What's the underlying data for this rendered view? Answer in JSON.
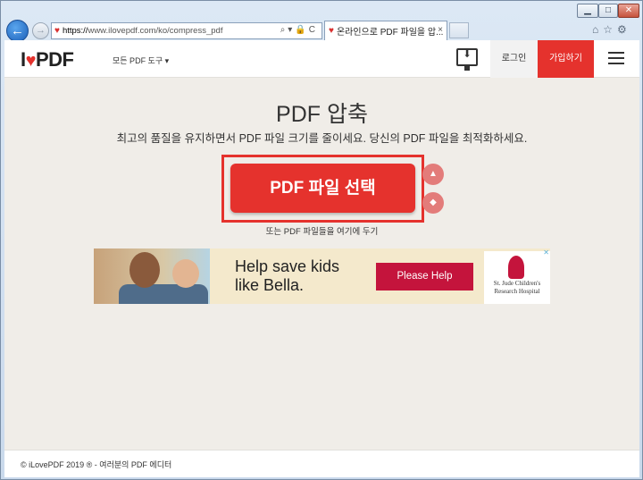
{
  "browser": {
    "window_buttons": {
      "minimize": "▁",
      "maximize": "□",
      "close": "✕"
    },
    "back_icon": "←",
    "forward_icon": "→",
    "address": {
      "protocol": "https://",
      "rest": "www.ilovepdf.com/ko/compress_pdf",
      "tools": "⌕▾🔒C"
    },
    "tab": {
      "title": "온라인으로 PDF 파일을 압...",
      "close": "×"
    },
    "tool_icons": "⌂☆⚙"
  },
  "header": {
    "logo_i": "I",
    "logo_pdf": "PDF",
    "tools_menu": "모든 PDF 도구 ▾",
    "desktop_icon": "⬇",
    "login": "로그인",
    "signup": "가입하기"
  },
  "main": {
    "title": "PDF 압축",
    "subtitle": "최고의 품질을 유지하면서 PDF 파일 크기를 줄이세요. 당신의 PDF 파일을 최적화하세요.",
    "select_button": "PDF 파일 선택",
    "drop_hint": "또는 PDF 파일들을 여기에 두기",
    "google_drive_icon": "▲",
    "dropbox_icon": "◆"
  },
  "ad": {
    "message_line1": "Help save kids",
    "message_line2": "like Bella.",
    "cta": "Please Help",
    "brand_line1": "St. Jude Children's",
    "brand_line2": "Research Hospital",
    "adchoices": "✕"
  },
  "footer": {
    "text": "© iLovePDF 2019 ® - 여러분의 PDF 에디터"
  },
  "colors": {
    "brand_red": "#e5322d",
    "ad_red": "#c4143c",
    "page_bg": "#f0ede8"
  }
}
